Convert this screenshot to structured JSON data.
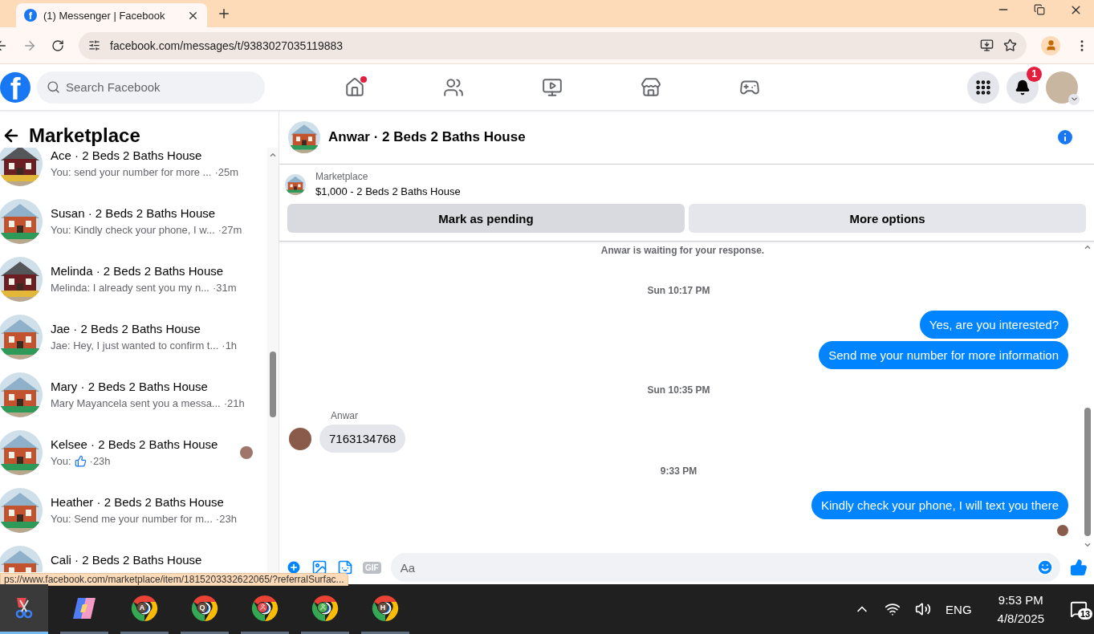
{
  "browser": {
    "tab": {
      "favicon": "f",
      "title": "(1) Messenger | Facebook"
    },
    "url": "facebook.com/messages/t/9383027035119883"
  },
  "header": {
    "logo": "f",
    "search": {
      "placeholder": "Search Facebook"
    },
    "nav": [
      {
        "kind": "home",
        "dot": true
      },
      {
        "kind": "friends",
        "dot": false
      },
      {
        "kind": "video",
        "dot": false
      },
      {
        "kind": "store",
        "dot": false
      },
      {
        "kind": "games",
        "dot": false
      }
    ],
    "notifications": {
      "badge": "1"
    }
  },
  "sidebar": {
    "title": "Marketplace",
    "conversations": [
      {
        "name": "Ace · 2 Beds 2 Baths House",
        "preview": "You: send your number for more ...",
        "time": "·25m",
        "kind": "text",
        "seen": false
      },
      {
        "name": "Susan · 2 Beds 2 Baths House",
        "preview": "You: Kindly check your phone, I w...",
        "time": "·27m",
        "kind": "text",
        "seen": false
      },
      {
        "name": "Melinda · 2 Beds 2 Baths House",
        "preview": "Melinda: I already sent you my n...",
        "time": "·31m",
        "kind": "text",
        "seen": false
      },
      {
        "name": "Jae · 2 Beds 2 Baths House",
        "preview": "Jae: Hey, I just wanted to confirm t...",
        "time": "·1h",
        "kind": "text",
        "seen": false
      },
      {
        "name": "Mary · 2 Beds 2 Baths House",
        "preview": "Mary Mayancela sent you a messa...",
        "time": "·21h",
        "kind": "text",
        "seen": false
      },
      {
        "name": "Kelsee · 2 Beds 2 Baths House",
        "preview": "You:",
        "time": "·23h",
        "kind": "like",
        "seen": true
      },
      {
        "name": "Heather · 2 Beds 2 Baths House",
        "preview": "You: Send me your number for m...",
        "time": "·23h",
        "kind": "text",
        "seen": false
      },
      {
        "name": "Cali · 2 Beds 2 Baths House",
        "kind": "cut",
        "seen": false
      }
    ]
  },
  "status_url": "ps://www.facebook.com/marketplace/item/1815203332622065/?referralSurfac...",
  "chat": {
    "title": "Anwar · 2 Beds 2 Baths House",
    "listing": {
      "label": "Marketplace",
      "title": "$1,000 - 2 Beds 2 Baths House"
    },
    "buttons": [
      {
        "label": "Mark as pending",
        "selected": true
      },
      {
        "label": "More options",
        "selected": false
      }
    ],
    "messages": [
      {
        "kind": "notice",
        "text": "Anwar is waiting for your response."
      },
      {
        "kind": "time",
        "text": "Sun 10:17 PM"
      },
      {
        "kind": "outgoing",
        "text": "Yes, are you interested?"
      },
      {
        "kind": "outgoing",
        "text": "Send me your number for more information"
      },
      {
        "kind": "time",
        "text": "Sun 10:35 PM"
      },
      {
        "kind": "incoming",
        "sender": "Anwar",
        "text": "7163134768"
      },
      {
        "kind": "time",
        "text": "9:33 PM"
      },
      {
        "kind": "outgoing",
        "text": "Kindly check your phone, I will text you there",
        "seen": true
      }
    ],
    "composer": {
      "gif": "GIF",
      "placeholder": "Aa"
    }
  },
  "taskbar": {
    "apps": [
      {
        "kind": "snip",
        "selected": true
      },
      {
        "kind": "copilot",
        "selected": false
      },
      {
        "kind": "chrome",
        "badge": "A",
        "selected": false
      },
      {
        "kind": "chrome",
        "badge": "Q",
        "selected": false
      },
      {
        "kind": "chrome-person",
        "color": "#e5484d",
        "selected": false
      },
      {
        "kind": "chrome-person",
        "color": "#4caf50",
        "selected": false
      },
      {
        "kind": "chrome",
        "badge": "H",
        "selected": false
      }
    ],
    "language": "ENG",
    "time": "9:53 PM",
    "date": "4/8/2025",
    "notifications": "13"
  }
}
